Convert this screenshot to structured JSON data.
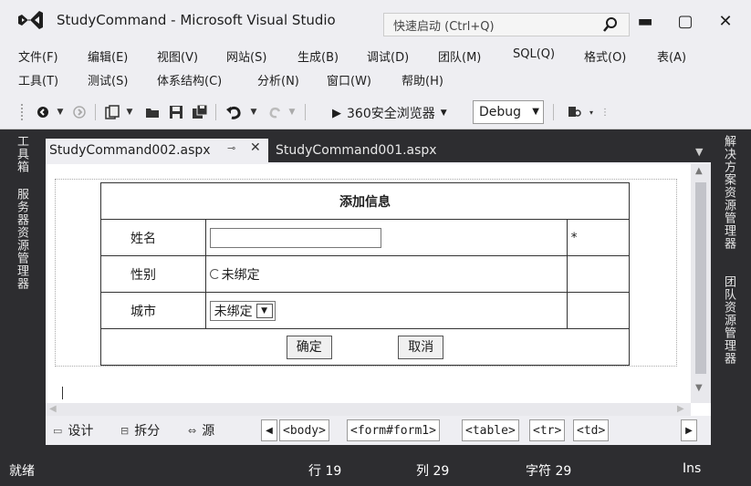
{
  "window": {
    "title": "StudyCommand - Microsoft Visual Studio",
    "quick_launch_placeholder": "快速启动 (Ctrl+Q)",
    "minimize": "▬",
    "maximize": "▢",
    "close": "✕"
  },
  "menu": {
    "row1": [
      "文件(F)",
      "编辑(E)",
      "视图(V)",
      "网站(S)",
      "生成(B)",
      "调试(D)",
      "团队(M)",
      "SQL(Q)",
      "格式(O)",
      "表(A)"
    ],
    "row2": [
      "工具(T)",
      "测试(S)",
      "体系结构(C)",
      "分析(N)",
      "窗口(W)",
      "帮助(H)"
    ]
  },
  "toolbar": {
    "browser_label": "360安全浏览器",
    "config_value": "Debug"
  },
  "left_panel": {
    "toolbox": "工具箱",
    "server_explorer": "服务器资源管理器"
  },
  "right_panel": {
    "solution_explorer": "解决方案资源管理器",
    "team_explorer": "团队资源管理器"
  },
  "tabs": {
    "active": "StudyCommand002.aspx",
    "inactive": "StudyCommand001.aspx"
  },
  "form": {
    "header": "添加信息",
    "rows": [
      {
        "label": "姓名",
        "value": "",
        "required_mark": "*"
      },
      {
        "label": "性别",
        "radio_label": "未绑定"
      },
      {
        "label": "城市",
        "select_value": "未绑定"
      }
    ],
    "ok_button": "确定",
    "cancel_button": "取消"
  },
  "view_bar": {
    "design": "设计",
    "split": "拆分",
    "source": "源",
    "breadcrumbs": [
      "<body>",
      "<form#form1>",
      "<table>",
      "<tr>",
      "<td>"
    ]
  },
  "status": {
    "ready": "就绪",
    "line": "行 19",
    "column": "列 29",
    "char": "字符 29",
    "mode": "Ins"
  },
  "colors": {
    "chrome": "#eeeef2",
    "dark": "#2d2d30",
    "vs_purple": "#68217a"
  }
}
